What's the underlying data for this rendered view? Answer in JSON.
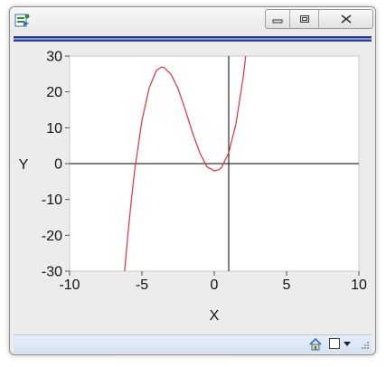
{
  "window": {
    "icons": {
      "app": "chart-app-icon",
      "minimize": "minimize-icon",
      "maximize": "maximize-icon",
      "close": "close-icon"
    }
  },
  "statusbar": {
    "icons": [
      "home-icon",
      "square-icon",
      "dropdown-arrow-icon",
      "resize-grip-icon"
    ]
  },
  "colors": {
    "curve": "#e0303c",
    "axis": "#000000",
    "title_rule": "#2b3e8f"
  },
  "chart_data": {
    "type": "line",
    "xlabel": "X",
    "ylabel": "Y",
    "xlim": [
      -10,
      10
    ],
    "ylim": [
      -30,
      30
    ],
    "x_ticks": [
      -10,
      -5,
      0,
      5,
      10
    ],
    "y_ticks": [
      -30,
      -20,
      -10,
      0,
      10,
      20,
      30
    ],
    "x_tick_labels": [
      "-10",
      "-5",
      "0",
      "5",
      "10"
    ],
    "y_tick_labels": [
      "-30",
      "-20",
      "-10",
      "0",
      "10",
      "20",
      "30"
    ],
    "grid": false,
    "reference_lines": {
      "x": 1,
      "y": 0
    },
    "series": [
      {
        "x": [
          -6.2,
          -6.0,
          -5.75,
          -5.5,
          -5.0,
          -4.5,
          -4.0,
          -3.67,
          -3.5,
          -3.0,
          -2.5,
          -2.0,
          -1.5,
          -1.0,
          -0.5,
          0.0,
          0.33,
          0.5,
          1.0,
          1.5,
          2.0,
          2.3
        ],
        "y": [
          -30.2,
          -21.0,
          -10.9,
          -1.9,
          12.0,
          21.1,
          26.0,
          26.9,
          26.9,
          25.0,
          20.9,
          15.0,
          8.6,
          3.0,
          -0.9,
          -2.0,
          -1.7,
          -1.1,
          3.0,
          11.1,
          24.0,
          34.2
        ]
      }
    ]
  }
}
